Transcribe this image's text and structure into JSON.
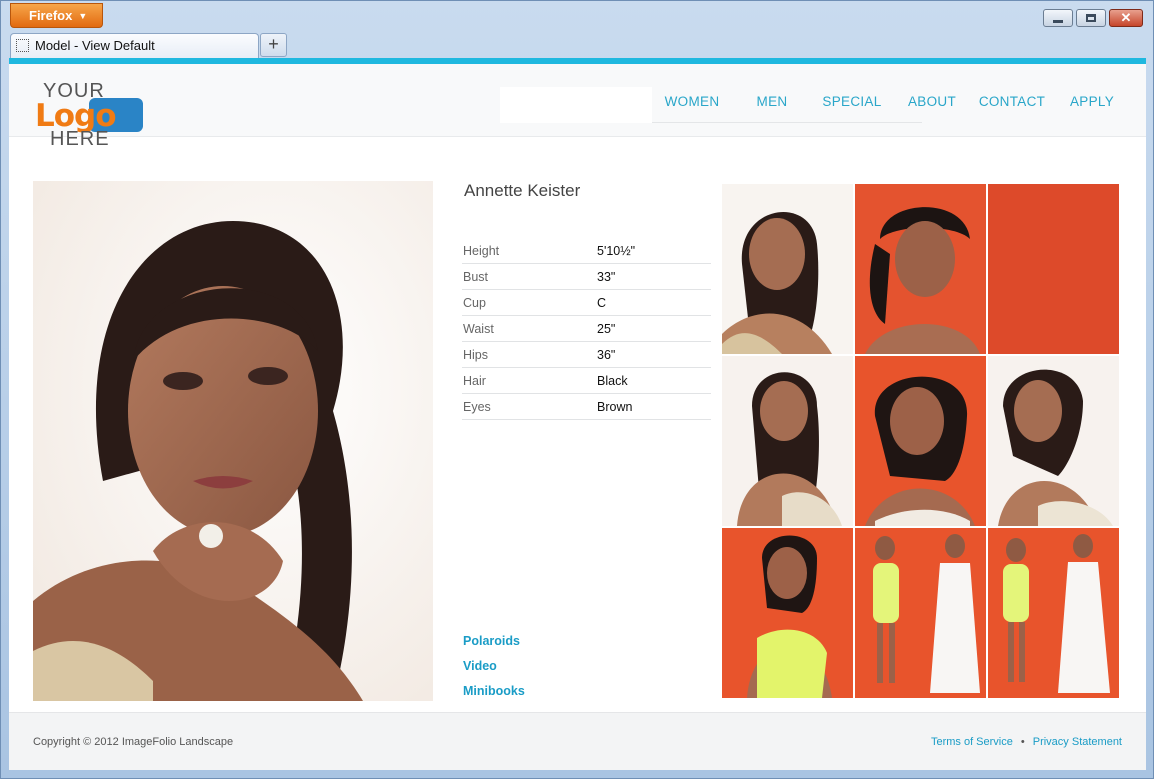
{
  "browser": {
    "menu_label": "Firefox",
    "tab_title": "Model - View Default",
    "new_tab": "+"
  },
  "logo": {
    "top": "YOUR",
    "middle": "Logo",
    "bottom": "HERE"
  },
  "nav": [
    "WOMEN",
    "MEN",
    "SPECIAL",
    "ABOUT",
    "CONTACT",
    "APPLY"
  ],
  "model": {
    "name": "Annette Keister",
    "stats": [
      {
        "label": "Height",
        "value": "5'10½\""
      },
      {
        "label": "Bust",
        "value": "33\""
      },
      {
        "label": "Cup",
        "value": "C"
      },
      {
        "label": "Waist",
        "value": "25\""
      },
      {
        "label": "Hips",
        "value": "36\""
      },
      {
        "label": "Hair",
        "value": "Black"
      },
      {
        "label": "Eyes",
        "value": "Brown"
      }
    ],
    "links": [
      "Polaroids",
      "Video",
      "Minibooks"
    ]
  },
  "footer": {
    "copyright": "Copyright © 2012 ImageFolio Landscape",
    "terms": "Terms of Service",
    "separator": "•",
    "privacy": "Privacy Statement"
  },
  "colors": {
    "accent": "#1fb8df",
    "nav_link": "#29a6c9",
    "thumb_orange": "#e8542c"
  }
}
